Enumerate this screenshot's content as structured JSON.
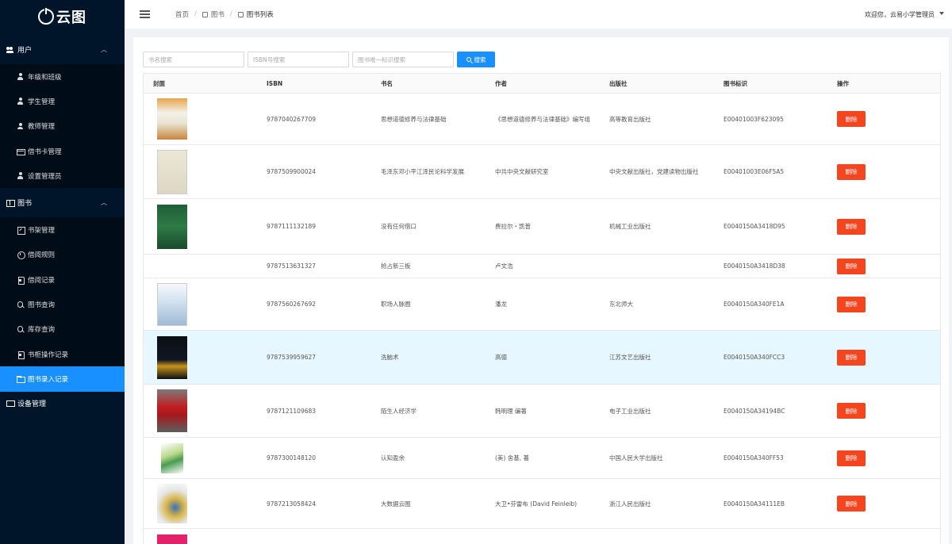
{
  "app": {
    "logo_text": "云图"
  },
  "sidebar": {
    "groups": [
      {
        "label": "用户",
        "items": [
          "年级和班级",
          "学生管理",
          "教师管理",
          "借书卡管理",
          "设置管理员"
        ]
      },
      {
        "label": "图书",
        "items": [
          "书架管理",
          "借阅规则",
          "借阅记录",
          "图书查询",
          "库存查询",
          "书柜操作记录",
          "图书录入记录"
        ]
      },
      {
        "label": "设备管理",
        "items": []
      }
    ],
    "active_item": "图书录入记录"
  },
  "header": {
    "breadcrumb": [
      "首页",
      "图书",
      "图书列表"
    ],
    "welcome": "欢迎您，云易小学管理员"
  },
  "search": {
    "title_placeholder": "书名搜索",
    "isbn_placeholder": "ISBN号搜索",
    "id_placeholder": "图书唯一标识搜索",
    "button_label": "搜索"
  },
  "table": {
    "columns": [
      "封面",
      "ISBN",
      "书名",
      "作者",
      "出版社",
      "图书标识",
      "操作"
    ],
    "delete_label": "删除",
    "rows": [
      {
        "isbn": "9787040267709",
        "title": "思想道德修养与法律基础",
        "author": "《思想道德修养与法律基础》编写组",
        "publisher": "高等教育出版社",
        "id": "E00401003F623095"
      },
      {
        "isbn": "9787509900024",
        "title": "毛泽东邓小平江泽民论科学发展",
        "author": "中共中央文献研究室",
        "publisher": "中央文献出版社，党建读物出版社",
        "id": "E00401003E06F5A5"
      },
      {
        "isbn": "9787111132189",
        "title": "没有任何借口",
        "author": "费拉尔・凯普",
        "publisher": "机械工业出版社",
        "id": "E0040150A3418D95"
      },
      {
        "isbn": "9787513631327",
        "title": "抢占新三板",
        "author": "卢文浩",
        "publisher": "",
        "id": "E0040150A3418D38"
      },
      {
        "isbn": "9787560267692",
        "title": "职场人脉圈",
        "author": "潘龙",
        "publisher": "东北师大",
        "id": "E0040150A340FE1A"
      },
      {
        "isbn": "9787539959627",
        "title": "洗脑术",
        "author": "高德",
        "publisher": "江苏文艺出版社",
        "id": "E0040150A340FCC3"
      },
      {
        "isbn": "9787121109683",
        "title": "陌生人经济学",
        "author": "韩明理 编著",
        "publisher": "电子工业出版社",
        "id": "E0040150A34194BC"
      },
      {
        "isbn": "9787300148120",
        "title": "认知盈余",
        "author": "(美) 舍基, 著",
        "publisher": "中国人民大学出版社",
        "id": "E0040150A340FF53"
      },
      {
        "isbn": "9787213058424",
        "title": "大数据云图",
        "author": "大卫•芬雷布 (David Feinleib)",
        "publisher": "浙江人民出版社",
        "id": "E0040150A34111EB"
      }
    ]
  },
  "colors": {
    "sidebar_bg": "#001529",
    "accent": "#1890ff",
    "danger": "#f5451f",
    "row_highlight": "#e6f7ff"
  }
}
